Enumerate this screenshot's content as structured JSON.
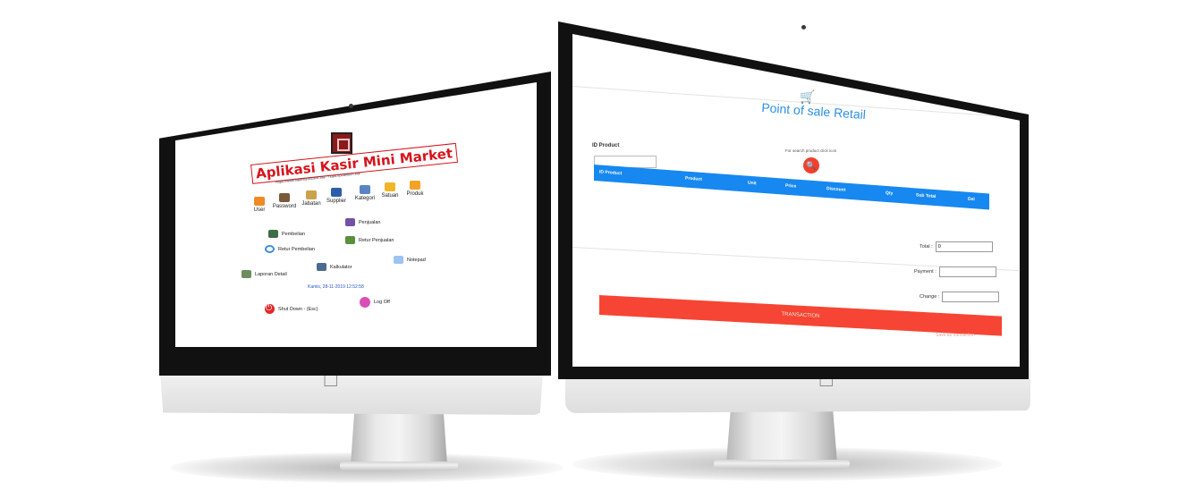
{
  "left_app": {
    "title": "Aplikasi Kasir Mini Market",
    "url_line": "https://www.hadesizonzone.site - https://pearltech.site",
    "menu": [
      {
        "label": "User",
        "icon": "user-icon",
        "color": "#f08a24"
      },
      {
        "label": "Password",
        "icon": "key-icon",
        "color": "#7a5a3a"
      },
      {
        "label": "Jabatan",
        "icon": "badge-icon",
        "color": "#c9a24a"
      },
      {
        "label": "Supplier",
        "icon": "person-icon",
        "color": "#2c5ea8"
      },
      {
        "label": "Kategori",
        "icon": "tag-icon",
        "color": "#5b84c4"
      },
      {
        "label": "Satuan",
        "icon": "box-icon",
        "color": "#f0b62a"
      },
      {
        "label": "Produk",
        "icon": "package-icon",
        "color": "#f2a325"
      }
    ],
    "functions": {
      "pembelian": {
        "label": "Pembelian",
        "icon": "cash-register-icon",
        "color": "#3f6e45"
      },
      "penjualan": {
        "label": "Penjualan",
        "icon": "shop-icon",
        "color": "#7452a6"
      },
      "retur_pembelian": {
        "label": "Retur Pembelian",
        "icon": "refresh-icon",
        "color": "#3b8fd9"
      },
      "retur_penjualan": {
        "label": "Retur Penjualan",
        "icon": "landscape-icon",
        "color": "#5a8f3c"
      },
      "notepad": {
        "label": "Notepad",
        "icon": "notepad-icon",
        "color": "#9cc4ef"
      },
      "laporan": {
        "label": "Laporan Detail",
        "icon": "report-icon",
        "color": "#6c8d5c"
      },
      "kalkulator": {
        "label": "Kalkulator",
        "icon": "calculator-icon",
        "color": "#4a6b8f"
      }
    },
    "datetime": "Kamis, 28-11-2019   12:52:58",
    "shutdown_label": "Shut Down - (Esc)",
    "logoff_label": "Log Off",
    "accent": "#d6141b"
  },
  "right_app": {
    "title": "Point of sale Retail",
    "id_product_label": "ID Product",
    "search_hint": "For search product click icon",
    "table_columns": [
      "ID Product",
      "Product",
      "Unit",
      "Price",
      "Discount",
      "Qty",
      "Sub Total",
      "Del"
    ],
    "total_label": "Total :",
    "total_value": "0",
    "payment_label": "Payment :",
    "payment_value": "",
    "change_label": "Change :",
    "change_value": "",
    "transaction_label": "TRANSACTION",
    "footnote": "Save as transaction",
    "accent": "#1688f0",
    "danger": "#f64534"
  }
}
